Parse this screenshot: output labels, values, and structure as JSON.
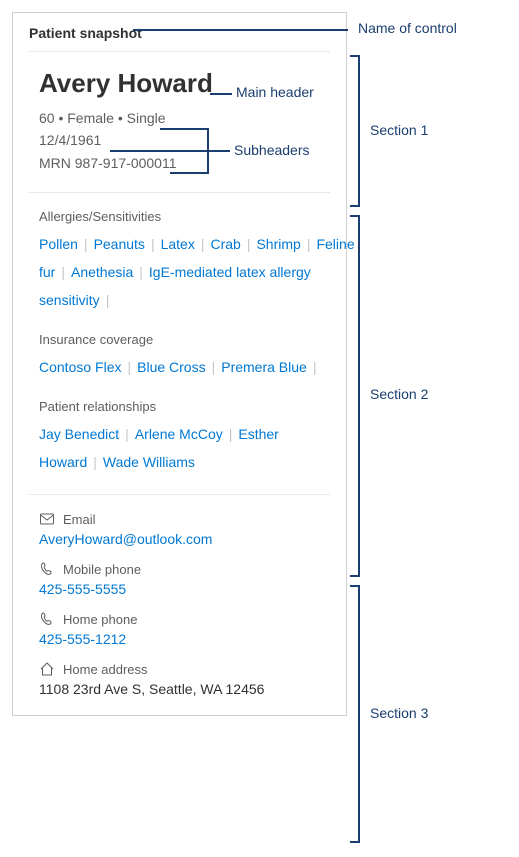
{
  "controlTitle": "Patient snapshot",
  "annotations": {
    "nameOfControl": "Name of control",
    "mainHeader": "Main header",
    "subheaders": "Subheaders",
    "section1": "Section 1",
    "section2": "Section 2",
    "section3": "Section 3"
  },
  "section1": {
    "name": "Avery Howard",
    "demo": "60 • Female • Single",
    "dob": "12/4/1961",
    "mrn": "MRN 987-917-000011"
  },
  "section2": {
    "allergies": {
      "label": "Allergies/Sensitivities",
      "items": [
        "Pollen",
        "Peanuts",
        "Latex",
        "Crab",
        "Shrimp",
        "Feline fur",
        "Anethesia",
        "IgE-mediated latex allergy sensitivity"
      ]
    },
    "insurance": {
      "label": "Insurance coverage",
      "items": [
        "Contoso Flex",
        "Blue Cross",
        "Premera Blue"
      ]
    },
    "relationships": {
      "label": "Patient relationships",
      "items": [
        "Jay Benedict",
        "Arlene McCoy",
        "Esther Howard",
        "Wade Williams"
      ]
    }
  },
  "section3": {
    "email": {
      "label": "Email",
      "value": "AveryHoward@outlook.com"
    },
    "mobile": {
      "label": "Mobile phone",
      "value": "425-555-5555"
    },
    "home": {
      "label": "Home phone",
      "value": "425-555-1212"
    },
    "address": {
      "label": "Home address",
      "value": "1108 23rd Ave S, Seattle, WA 12456"
    }
  }
}
